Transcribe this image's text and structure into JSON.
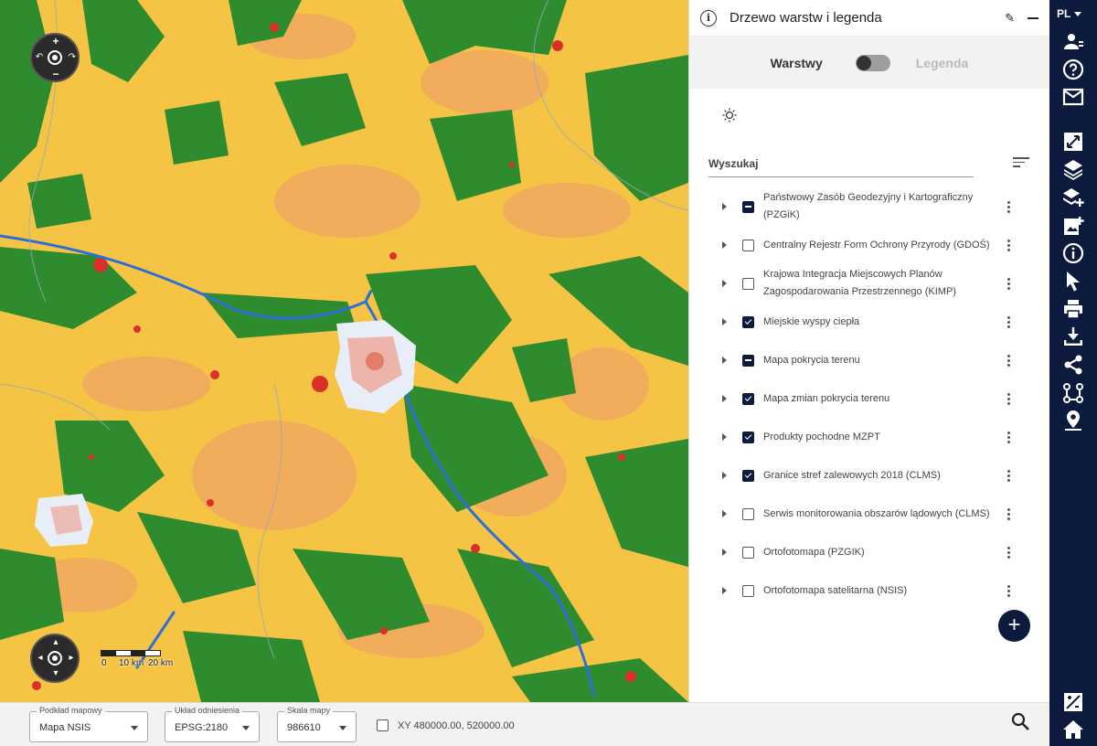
{
  "panel": {
    "title": "Drzewo warstw i legenda",
    "toggle_left": "Warstwy",
    "toggle_right": "Legenda",
    "search_label": "Wyszukaj",
    "layers": [
      {
        "label": "Państwowy Zasób Geodezyjny i Kartograficzny (PZGiK)",
        "state": "mixed"
      },
      {
        "label": "Centralny Rejestr Form Ochrony Przyrody (GDOŚ)",
        "state": "unchecked"
      },
      {
        "label": "Krajowa Integracja Miejscowych Planów Zagospodarowania Przestrzennego (KIMP)",
        "state": "unchecked"
      },
      {
        "label": "Miejskie wyspy ciepła",
        "state": "checked"
      },
      {
        "label": "Mapa pokrycia terenu",
        "state": "mixed"
      },
      {
        "label": "Mapa zmian pokrycia terenu",
        "state": "checked"
      },
      {
        "label": "Produkty pochodne MZPT",
        "state": "checked"
      },
      {
        "label": "Granice stref zalewowych 2018 (CLMS)",
        "state": "checked"
      },
      {
        "label": "Serwis monitorowania obszarów lądowych (CLMS)",
        "state": "unchecked"
      },
      {
        "label": "Ortofotomapa (PZGIK)",
        "state": "unchecked"
      },
      {
        "label": "Ortofotomapa satelitarna (NSIS)",
        "state": "unchecked"
      }
    ],
    "add_symbol": "+"
  },
  "toolbar": {
    "language": "PL",
    "tools": [
      "user-icon",
      "help-icon",
      "mail-icon",
      "extent-icon",
      "layers-icon",
      "add-layer-icon",
      "add-service-icon",
      "info-icon",
      "select-icon",
      "print-icon",
      "download-icon",
      "share-icon",
      "measure-icon",
      "location-icon",
      "draw-icon",
      "home-icon"
    ]
  },
  "map": {
    "scale_labels": [
      "0",
      "10 km",
      "20 km"
    ]
  },
  "bottom": {
    "basemap_label": "Podkład mapowy",
    "basemap_value": "Mapa NSIS",
    "crs_label": "Układ odniesienia",
    "crs_value": "EPSG:2180",
    "scale_label": "Skala mapy",
    "scale_value": "986610",
    "coords": "XY 480000.00, 520000.00"
  },
  "colors": {
    "accent": "#0b1a3d",
    "cropland": "#f6c33f",
    "forest": "#2e8b2e",
    "urban": "#d9302a",
    "water": "#2d6fd6",
    "grassland": "#f0a860"
  }
}
